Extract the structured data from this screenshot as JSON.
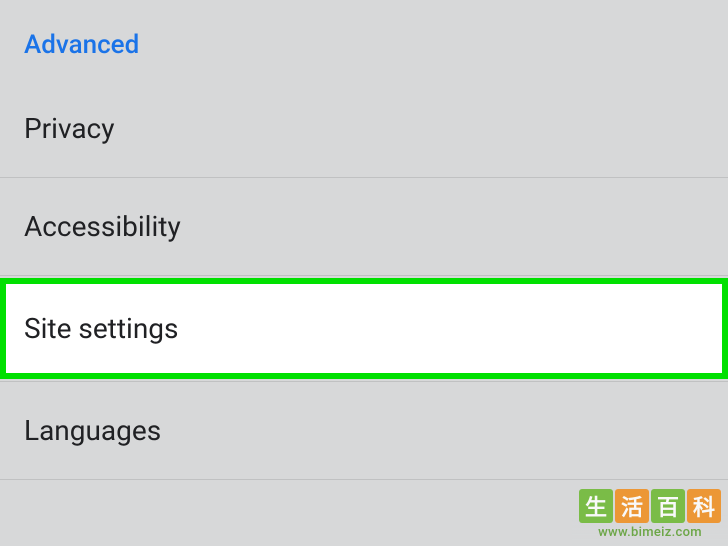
{
  "section": {
    "header": "Advanced",
    "items": [
      {
        "label": "Privacy",
        "highlighted": false
      },
      {
        "label": "Accessibility",
        "highlighted": false
      },
      {
        "label": "Site settings",
        "highlighted": true
      },
      {
        "label": "Languages",
        "highlighted": false
      }
    ]
  },
  "watermark": {
    "chars": [
      "生",
      "活",
      "百",
      "科"
    ],
    "url": "www.bimeiz.com"
  }
}
